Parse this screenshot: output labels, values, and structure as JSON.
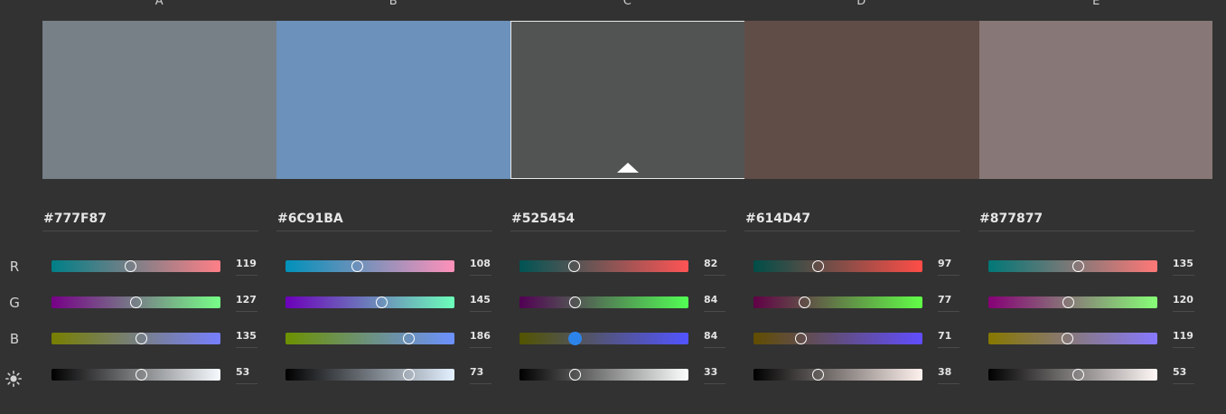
{
  "rows": [
    {
      "label": "R",
      "kind": "r"
    },
    {
      "label": "G",
      "kind": "g"
    },
    {
      "label": "B",
      "kind": "b"
    },
    {
      "label": "",
      "kind": "brightness",
      "icon": "sun-icon"
    }
  ],
  "selected_index": 2,
  "swatches": [
    {
      "letter": "A",
      "color": "#777F87",
      "hex": "#777F87",
      "values": [
        119,
        127,
        135,
        53
      ]
    },
    {
      "letter": "B",
      "color": "#6C91BA",
      "hex": "#6C91BA",
      "values": [
        108,
        145,
        186,
        73
      ]
    },
    {
      "letter": "C",
      "color": "#525454",
      "hex": "#525454",
      "values": [
        82,
        84,
        84,
        33
      ]
    },
    {
      "letter": "D",
      "color": "#614D47",
      "hex": "#614D47",
      "values": [
        97,
        77,
        71,
        38
      ]
    },
    {
      "letter": "E",
      "color": "#877877",
      "hex": "#877877",
      "values": [
        135,
        120,
        119,
        53
      ]
    }
  ],
  "active_slider": {
    "swatch": 2,
    "row": 2
  }
}
